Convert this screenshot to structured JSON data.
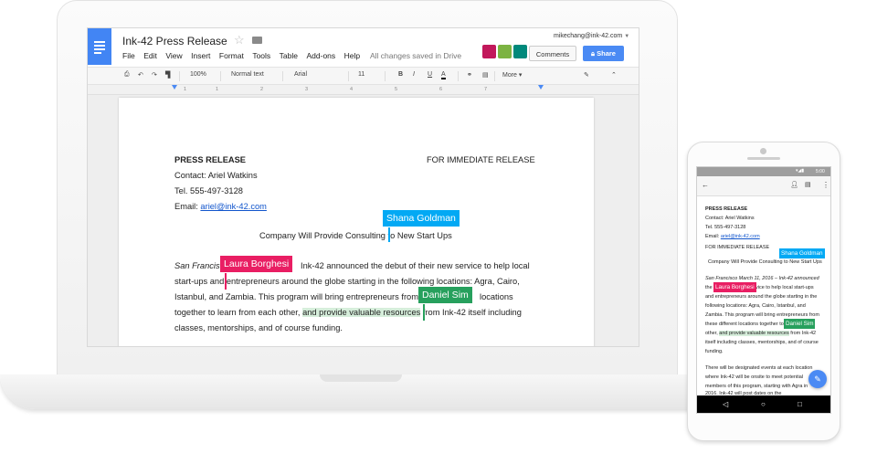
{
  "doc": {
    "title": "Ink-42 Press Release",
    "menu": [
      "File",
      "Edit",
      "View",
      "Insert",
      "Format",
      "Tools",
      "Table",
      "Add-ons",
      "Help"
    ],
    "saved_status": "All changes saved in Drive",
    "account": "mikechang@ink-42.com",
    "comments_label": "Comments",
    "share_label": "Share"
  },
  "toolbar": {
    "zoom": "100%",
    "style": "Normal text",
    "font": "Arial",
    "size": "11",
    "bold": "B",
    "italic": "I",
    "underline": "U",
    "text_color": "A",
    "more": "More"
  },
  "ruler": [
    "1",
    "1",
    "2",
    "3",
    "4",
    "5",
    "6",
    "7"
  ],
  "body": {
    "press_release": "PRESS RELEASE",
    "immediate": "FOR IMMEDIATE RELEASE",
    "contact": "Contact: Ariel Watkins",
    "tel": "Tel. 555-497-3128",
    "email_label": "Email: ",
    "email": "ariel@ink-42.com",
    "headline": "Company Will Provide Consulting to New Start Ups",
    "para_l1_ital": "San Francis",
    "para_l1_rest": "Ink-42 announced the debut of their new service to help local",
    "para_l2": "start-ups and entrepreneurs around the globe starting in the following locations: Agra, Cairo,",
    "para_l3a": "Istanbul, and Zambia. This program will bring entrepreneurs from",
    "para_l3b": "locations",
    "para_l4a": "together to learn from each other,",
    "para_l4hl": "and provide valuable resources",
    "para_l4b": "from Ink-42 itself including",
    "para_l5": "classes, mentorships, and of course funding."
  },
  "collaborators": {
    "shana": {
      "name": "Shana Goldman",
      "color": "#03a9f4"
    },
    "laura": {
      "name": "Laura Borghesi",
      "color": "#e91e63"
    },
    "daniel": {
      "name": "Daniel Sim",
      "color": "#27a05d"
    }
  },
  "phone": {
    "time": "5:00",
    "press_release": "PRESS RELEASE",
    "contact": "Contact: Ariel Watkins",
    "tel": "Tel. 555-497-3128",
    "email_label": "Email: ",
    "email": "ariel@ink-42.com",
    "immediate": "FOR IMMEDIATE RELEASE",
    "headline": "Company Will Provide Consulting to New Start Ups",
    "l1": "San Francisco March 11, 2016 – Ink-42 announced",
    "l2": "the",
    "l2b": "vice to help local start-ups",
    "l3": "and entrepreneurs around the globe starting in the",
    "l4": "following locations: Agra, Cairo, Istanbul, and",
    "l5": "Zambia. This program will bring entrepreneurs from",
    "l6": "these different locations together to",
    "l7a": "other,",
    "l7hl": "and provide valuable resources",
    "l7b": "from Ink-42",
    "l8": "itself including classes, mentorships, and of course",
    "l9": "funding.",
    "l10": "There will be designated events at each location",
    "l11": "where Ink-42 will be onsite to meet potential",
    "l12": "members of this program, starting with Agra in",
    "l13": "2016. Ink-42 will post dates on the"
  }
}
